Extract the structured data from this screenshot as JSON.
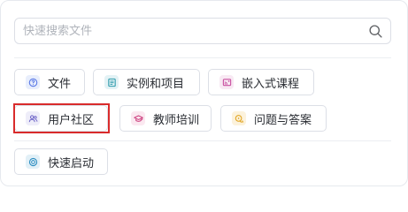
{
  "search": {
    "placeholder": "快速搜索文件",
    "value": "",
    "icon": "search-icon"
  },
  "shortcuts_row1": [
    {
      "label": "文件",
      "icon": "file-help-icon",
      "icon_bg": "#e8eefc",
      "icon_color": "#5a79e6"
    },
    {
      "label": "实例和项目",
      "icon": "document-icon",
      "icon_bg": "#e3f2f5",
      "icon_color": "#2c9aab"
    },
    {
      "label": "嵌入式课程",
      "icon": "chip-cast-icon",
      "icon_bg": "#f8e9f3",
      "icon_color": "#c84fa0"
    }
  ],
  "shortcuts_row2": [
    {
      "label": "用户社区",
      "icon": "users-icon",
      "icon_bg": "#eeedf9",
      "icon_color": "#6c63c7"
    },
    {
      "label": "教师培训",
      "icon": "graduation-cap-icon",
      "icon_bg": "#fbe8f0",
      "icon_color": "#cc3f7e"
    },
    {
      "label": "问题与答案",
      "icon": "question-chat-icon",
      "icon_bg": "#fcf2dc",
      "icon_color": "#e0a21a"
    }
  ],
  "shortcuts_row3": [
    {
      "label": "快速启动",
      "icon": "quick-start-icon",
      "icon_bg": "#e2f0f7",
      "icon_color": "#2a8cc0"
    }
  ],
  "highlighted_item": "用户社区",
  "colors": {
    "highlight_border": "#d92b2b",
    "border": "#dcdfe6"
  }
}
